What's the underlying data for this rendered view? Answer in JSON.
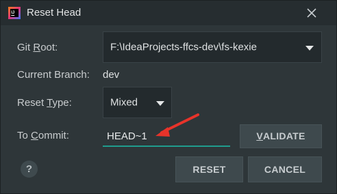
{
  "window": {
    "title": "Reset Head"
  },
  "form": {
    "git_root": {
      "label_pre": "Git ",
      "label_mnemonic": "R",
      "label_post": "oot:",
      "value": "F:\\IdeaProjects-ffcs-dev\\fs-kexie"
    },
    "current_branch": {
      "label": "Current Branch:",
      "value": "dev"
    },
    "reset_type": {
      "label_pre": "Reset ",
      "label_mnemonic": "T",
      "label_post": "ype:",
      "value": "Mixed"
    },
    "to_commit": {
      "label_pre": "To ",
      "label_mnemonic": "C",
      "label_post": "ommit:",
      "value": "HEAD~1"
    }
  },
  "buttons": {
    "validate_mnemonic": "V",
    "validate_rest": "ALIDATE",
    "reset": "RESET",
    "cancel": "CANCEL",
    "help": "?"
  },
  "colors": {
    "dialog_bg": "#2e3639",
    "titlebar_bg": "#262d30",
    "input_focus_underline": "#1f9d8e",
    "annotation_arrow": "#e8332a"
  },
  "icons": {
    "app": "intellij-idea-icon",
    "close": "close-icon",
    "dropdown": "chevron-down-icon",
    "help": "help-icon",
    "annotation": "red-arrow-annotation"
  }
}
